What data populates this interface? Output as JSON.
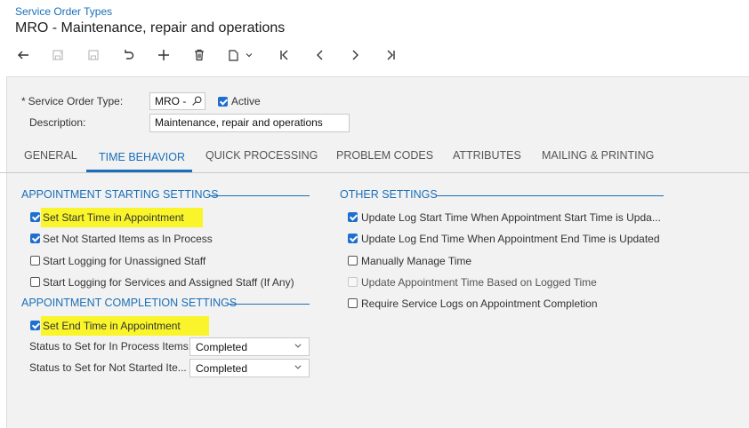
{
  "header": {
    "breadcrumb": "Service Order Types",
    "title": "MRO - Maintenance, repair and operations"
  },
  "toolbar": {
    "buttons": [
      "back-icon",
      "save-icon",
      "save-close-icon",
      "undo-icon",
      "add-icon",
      "delete-icon",
      "copy-paste-icon",
      "first-icon",
      "prev-icon",
      "next-icon",
      "last-icon"
    ]
  },
  "form": {
    "order_type_label": "Service Order Type:",
    "order_type_value": "MRO -",
    "active_label": "Active",
    "active_checked": true,
    "description_label": "Description:",
    "description_value": "Maintenance, repair and operations"
  },
  "tabs": [
    {
      "label": "GENERAL"
    },
    {
      "label": "TIME BEHAVIOR"
    },
    {
      "label": "QUICK PROCESSING"
    },
    {
      "label": "PROBLEM CODES"
    },
    {
      "label": "ATTRIBUTES"
    },
    {
      "label": "MAILING & PRINTING"
    }
  ],
  "active_tab": "TIME BEHAVIOR",
  "appt_start": {
    "title": "APPOINTMENT STARTING SETTINGS",
    "items": [
      {
        "label": "Set Start Time in Appointment",
        "checked": true,
        "highlight": true
      },
      {
        "label": "Set Not Started Items as In Process",
        "checked": true
      },
      {
        "label": "Start Logging for Unassigned Staff",
        "checked": false
      },
      {
        "label": "Start Logging for Services and Assigned Staff (If Any)",
        "checked": false
      }
    ]
  },
  "appt_completion": {
    "title": "APPOINTMENT COMPLETION SETTINGS",
    "set_end_time_label": "Set End Time in Appointment",
    "set_end_time_checked": true,
    "in_process_label": "Status to Set for In Process Items:",
    "in_process_value": "Completed",
    "not_started_label": "Status to Set for Not Started Ite...",
    "not_started_value": "Completed"
  },
  "other": {
    "title": "OTHER SETTINGS",
    "items": [
      {
        "label": "Update Log Start Time When Appointment Start Time is Upda...",
        "checked": true
      },
      {
        "label": "Update Log End Time When Appointment End Time is Updated",
        "checked": true
      },
      {
        "label": "Manually Manage Time",
        "checked": false
      },
      {
        "label": "Update Appointment Time Based on Logged Time",
        "checked": false,
        "disabled": true
      },
      {
        "label": "Require Service Logs on Appointment Completion",
        "checked": false
      }
    ]
  },
  "colors": {
    "accent": "#1a6fb8",
    "highlight": "#f9f52a",
    "checkbox": "#1e6fd0"
  }
}
